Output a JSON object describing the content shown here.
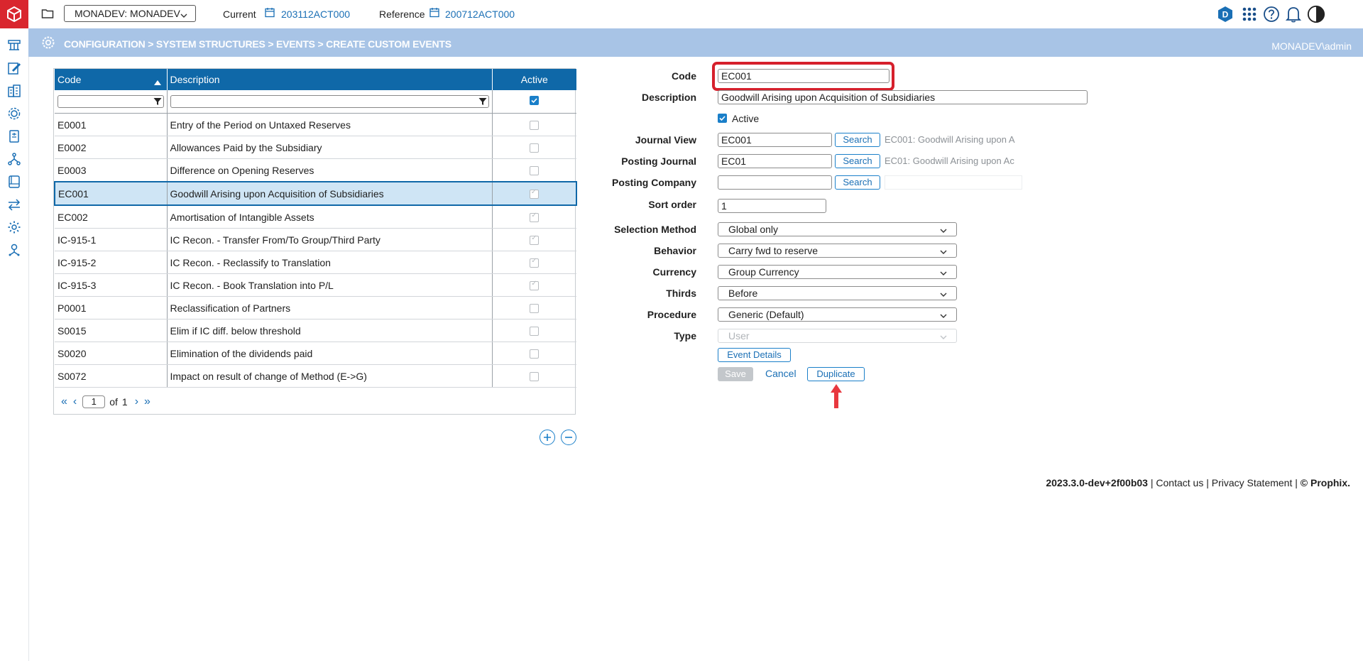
{
  "topbar": {
    "environment": "MONADEV: MONADEV",
    "current_label": "Current",
    "current_value": "203112ACT000",
    "reference_label": "Reference",
    "reference_value": "200712ACT000",
    "badge_letter": "D"
  },
  "breadcrumb": "CONFIGURATION > SYSTEM STRUCTURES > EVENTS > CREATE CUSTOM EVENTS",
  "user": "MONADEV\\admin",
  "sidebar": {
    "icons": [
      "structure-icon",
      "edit-icon",
      "building-icon",
      "gear-network-icon",
      "form-icon",
      "hierarchy-icon",
      "book-icon",
      "transfer-icon",
      "settings-icon",
      "user-network-icon"
    ]
  },
  "grid": {
    "columns": {
      "code": "Code",
      "description": "Description",
      "active": "Active"
    },
    "rows": [
      {
        "code": "E0001",
        "description": "Entry of the Period on Untaxed Reserves",
        "active": false
      },
      {
        "code": "E0002",
        "description": "Allowances Paid by the Subsidiary",
        "active": false
      },
      {
        "code": "E0003",
        "description": "Difference on Opening Reserves",
        "active": false
      },
      {
        "code": "EC001",
        "description": "Goodwill Arising upon Acquisition of Subsidiaries",
        "active": true,
        "selected": true
      },
      {
        "code": "EC002",
        "description": "Amortisation of Intangible Assets",
        "active": true
      },
      {
        "code": "IC-915-1",
        "description": "IC Recon. - Transfer From/To Group/Third Party",
        "active": true
      },
      {
        "code": "IC-915-2",
        "description": "IC Recon. - Reclassify to Translation",
        "active": true
      },
      {
        "code": "IC-915-3",
        "description": "IC Recon. - Book Translation into P/L",
        "active": true
      },
      {
        "code": "P0001",
        "description": "Reclassification of Partners",
        "active": false
      },
      {
        "code": "S0015",
        "description": "Elim if IC diff. below threshold",
        "active": false
      },
      {
        "code": "S0020",
        "description": "Elimination of the dividends paid",
        "active": false
      },
      {
        "code": "S0072",
        "description": "Impact on result of change of Method (E->G)",
        "active": false
      }
    ],
    "pager": {
      "page": "1",
      "of_label": "of",
      "total": "1"
    }
  },
  "form": {
    "code_label": "Code",
    "code_value": "EC001",
    "description_label": "Description",
    "description_value": "Goodwill Arising upon Acquisition of Subsidiaries",
    "active_label": "Active",
    "journal_view_label": "Journal View",
    "journal_view_value": "EC001",
    "journal_view_lookup": "EC001: Goodwill Arising upon A",
    "posting_journal_label": "Posting Journal",
    "posting_journal_value": "EC01",
    "posting_journal_lookup": "EC01: Goodwill Arising upon Ac",
    "posting_company_label": "Posting Company",
    "posting_company_value": "",
    "search_label": "Search",
    "sort_order_label": "Sort order",
    "sort_order_value": "1",
    "selection_method_label": "Selection Method",
    "selection_method_value": "Global only",
    "behavior_label": "Behavior",
    "behavior_value": "Carry fwd to reserve",
    "currency_label": "Currency",
    "currency_value": "Group Currency",
    "thirds_label": "Thirds",
    "thirds_value": "Before",
    "procedure_label": "Procedure",
    "procedure_value": "Generic (Default)",
    "type_label": "Type",
    "type_value": "User",
    "event_details_label": "Event Details",
    "save_label": "Save",
    "cancel_label": "Cancel",
    "duplicate_label": "Duplicate"
  },
  "footer": {
    "version": "2023.3.0-dev+2f00b03",
    "sep": " | ",
    "contact": "Contact us",
    "privacy": "Privacy Statement",
    "copyright": "© Prophix."
  },
  "colors": {
    "header_blue": "#0f68a8",
    "crumb_bar": "#a8c4e6",
    "highlight_red": "#d6202c",
    "logo_red": "#d9262e"
  }
}
